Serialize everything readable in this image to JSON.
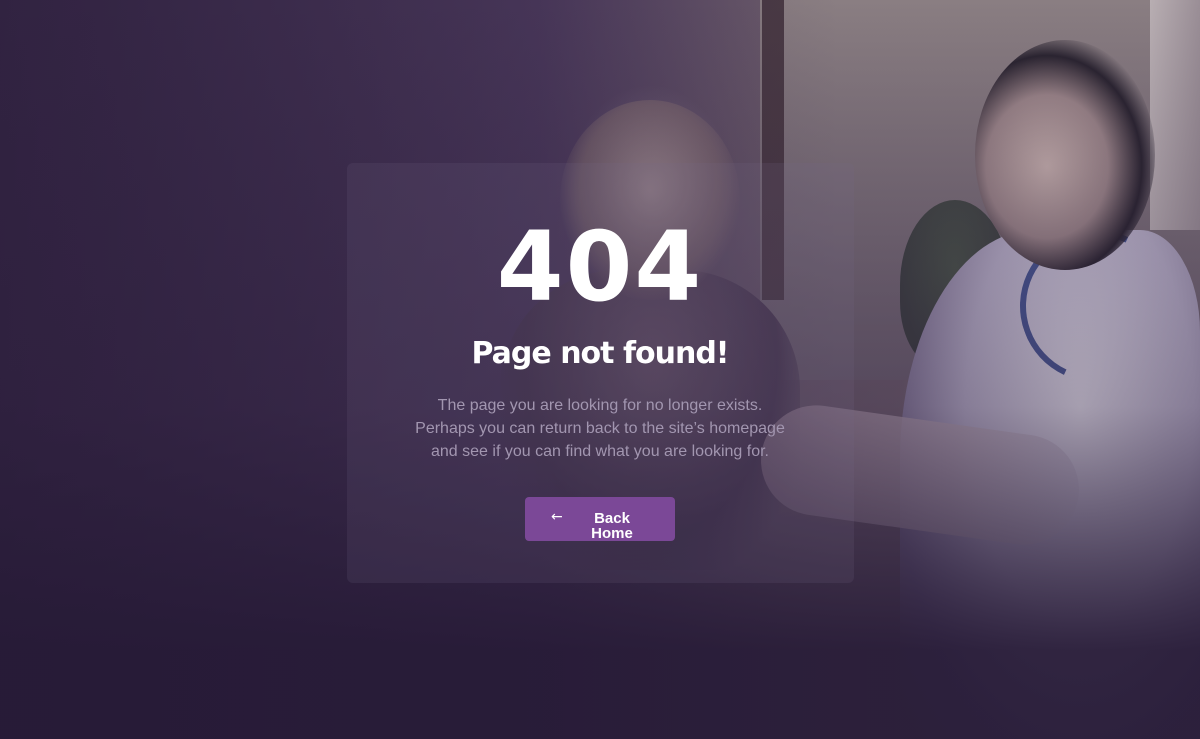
{
  "error": {
    "code": "404",
    "title": "Page not found!",
    "description_lines": [
      "The page you are looking for no longer exists.",
      "Perhaps you can return back to the site’s homepage",
      "and see if you can find what you are looking for."
    ]
  },
  "back_button": {
    "icon": "←",
    "icon_name": "arrow-left-icon",
    "label": "Back Home"
  },
  "colors": {
    "button_bg": "#7b4897",
    "overlay": "#2a1c3a",
    "description_text": "#a296b0"
  }
}
